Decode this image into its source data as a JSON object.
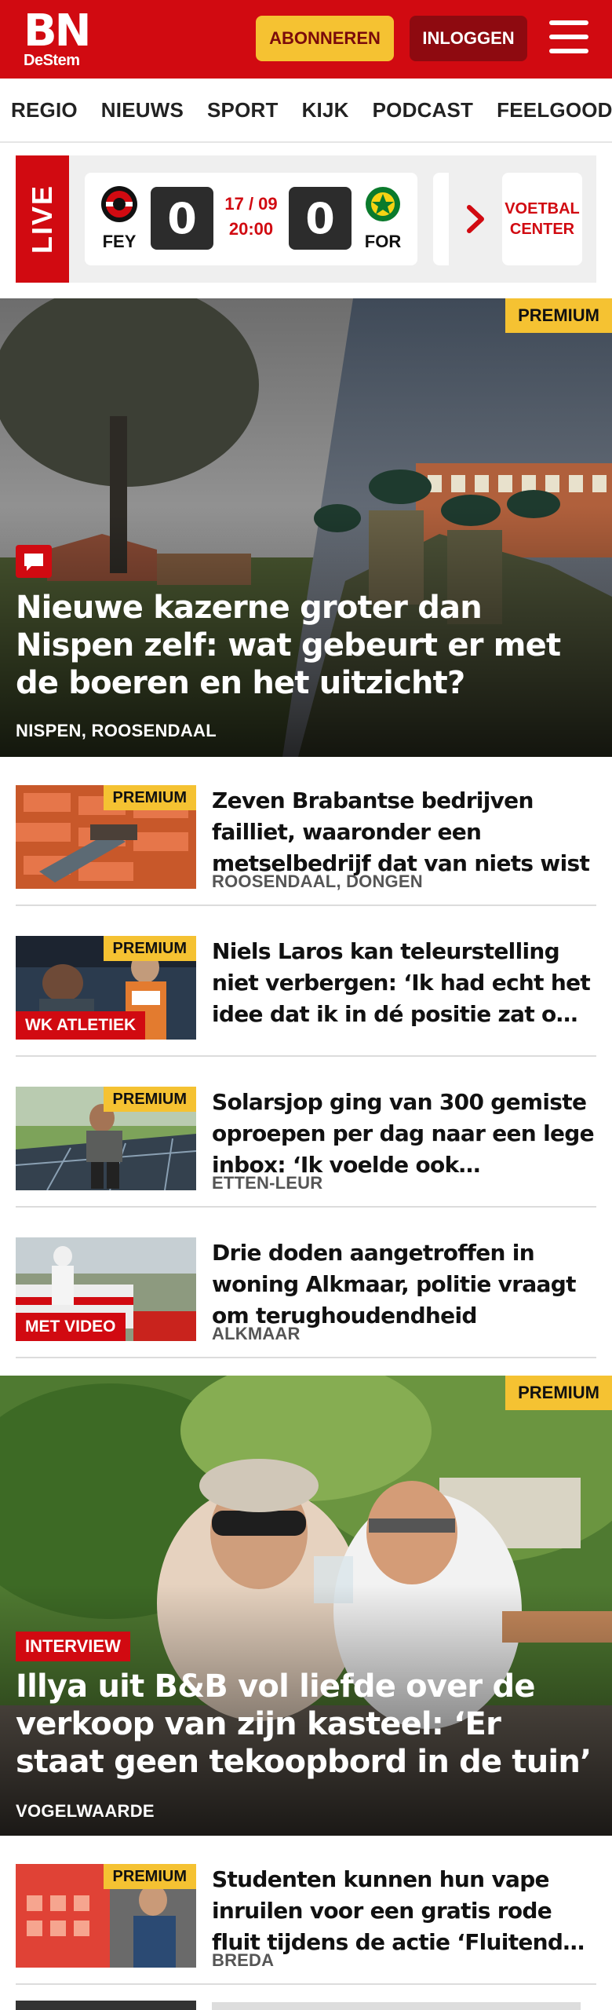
{
  "header": {
    "logo_main": "BN",
    "logo_sub": "DeStem",
    "subscribe_label": "ABONNEREN",
    "login_label": "INLOGGEN",
    "menu_icon": "hamburger-menu-icon"
  },
  "nav": {
    "items": [
      "REGIO",
      "NIEUWS",
      "SPORT",
      "KIJK",
      "PODCAST",
      "FEELGOOD"
    ]
  },
  "live": {
    "label": "LIVE",
    "match": {
      "home_abbr": "FEY",
      "away_abbr": "FOR",
      "home_score": "0",
      "away_score": "0",
      "date": "17 / 09",
      "time": "20:00"
    },
    "center_label_line1": "VOETBAL",
    "center_label_line2": "CENTER"
  },
  "hero1": {
    "badge": "PREMIUM",
    "title": "Nieuwe kazerne groter dan Nispen zelf: wat gebeurt er met de boeren en het uitzicht?",
    "location": "NISPEN, ROOSENDAAL",
    "comment_icon": "comment-icon"
  },
  "articles": [
    {
      "badge": "PREMIUM",
      "tag": "",
      "title": "Zeven Brabantse bedrijven failliet, waaronder een metselbe­drijf dat van niets wist",
      "location": "ROOSENDAAL, DONGEN"
    },
    {
      "badge": "PREMIUM",
      "tag": "WK ATLETIEK",
      "title": "Niels Laros kan teleurstelling niet verbergen: ‘Ik had echt het idee dat ik in dé positie zat om te winnen’",
      "location": ""
    },
    {
      "badge": "PREMIUM",
      "tag": "",
      "title": "Solarsjop ging van 300 gemiste oproepen per dag naar een lege inbox: ‘Ik voelde ook opluchting’",
      "location": "ETTEN-LEUR"
    },
    {
      "badge": "",
      "tag": "MET VIDEO",
      "title": "Drie doden aangetroffen in woning Alkmaar, politie vraagt om terughoudendheid",
      "location": "ALKMAAR"
    }
  ],
  "hero2": {
    "badge": "PREMIUM",
    "tag": "INTERVIEW",
    "title": "Illya uit B&B vol liefde over de verkoop van zijn kasteel: ‘Er staat geen tekoopbord in de tuin’",
    "location": "VOGELWAARDE"
  },
  "article5": {
    "badge": "PREMIUM",
    "title": "Studenten kunnen hun vape inruilen voor een gratis rode fluit tijdens de actie ‘Fluitend door het leven’",
    "location": "BREDA"
  },
  "colors": {
    "brand_red": "#d10a11",
    "premium_yellow": "#f5c232",
    "login_dark_red": "#8e0a10"
  }
}
